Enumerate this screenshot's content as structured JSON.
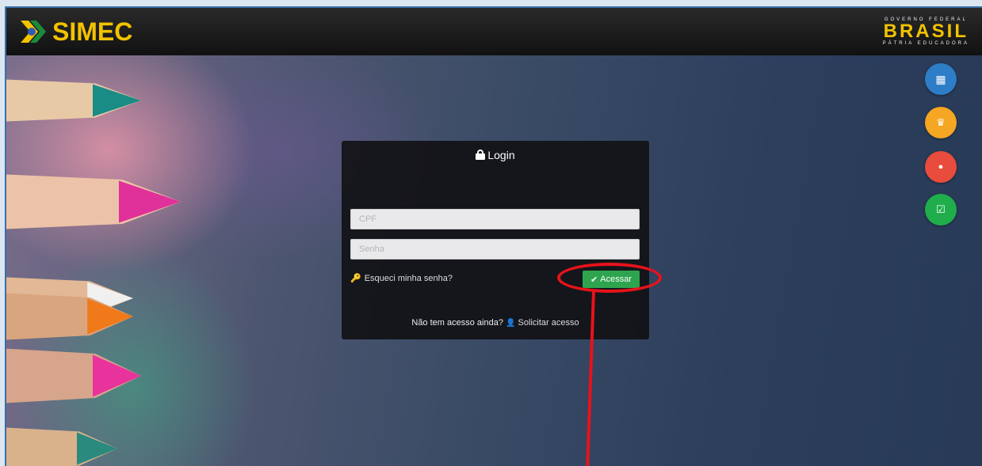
{
  "header": {
    "logo_text": "SIMEC",
    "gov_top": "GOVERNO FEDERAL",
    "gov_brand": "BRASIL",
    "gov_bottom": "PÁTRIA EDUCADORA"
  },
  "login": {
    "title": "Login",
    "cpf_placeholder": "CPF",
    "senha_placeholder": "Senha",
    "forgot_label": "Esqueci minha senha?",
    "submit_label": "Acessar",
    "no_access_text": "Não tem acesso ainda?",
    "request_access_label": "Solicitar acesso"
  },
  "side_buttons": [
    {
      "name": "apps-grid-icon",
      "glyph": "▦",
      "color": "#2e7dc7"
    },
    {
      "name": "trophy-icon",
      "glyph": "🏆",
      "color": "#f5a623"
    },
    {
      "name": "chat-icon",
      "glyph": "●",
      "color": "#e84c3d"
    },
    {
      "name": "check-square-icon",
      "glyph": "☑",
      "color": "#1fae4b"
    }
  ],
  "colors": {
    "accent_green": "#2ea44f",
    "callout_red": "#e8121a",
    "brand_yellow": "#f2c200"
  }
}
